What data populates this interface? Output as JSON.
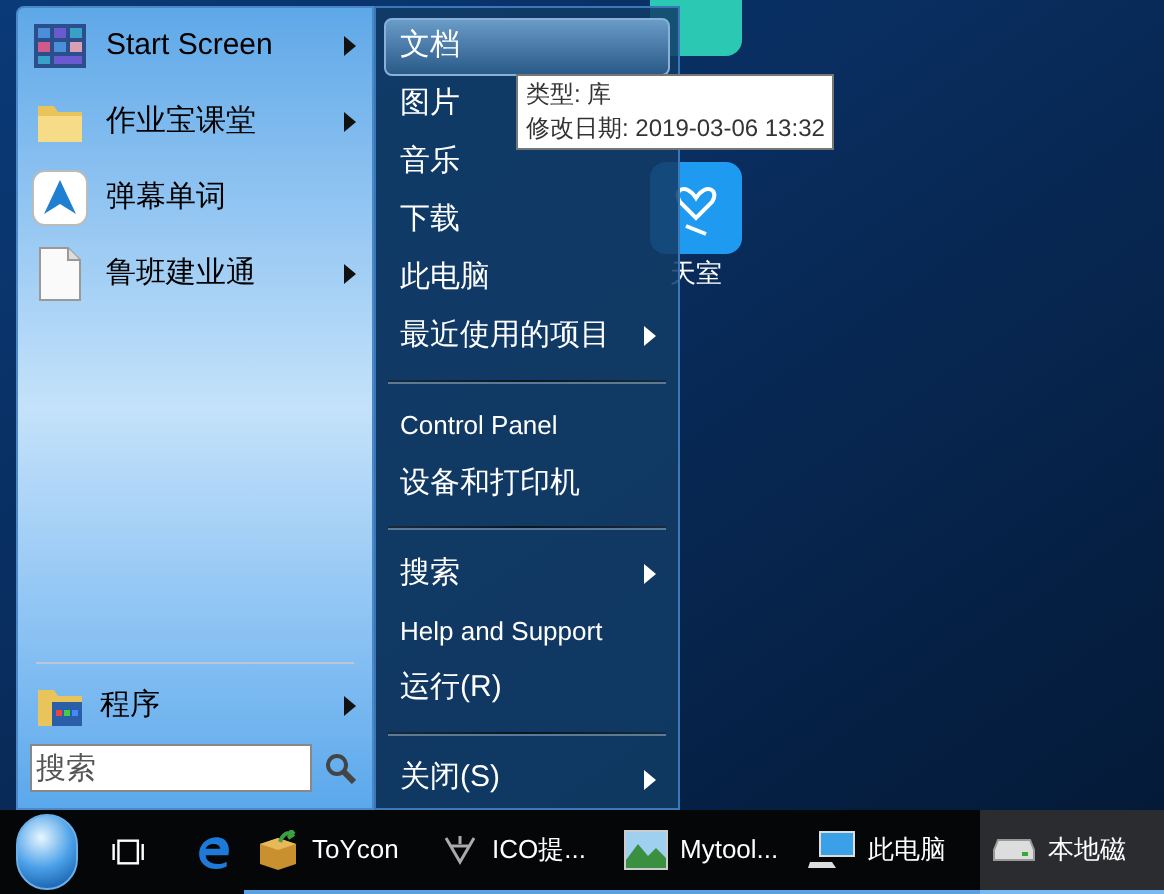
{
  "desktop_icon": {
    "label": "天室"
  },
  "start_menu": {
    "programs": [
      {
        "label": "Start Screen",
        "has_submenu": true
      },
      {
        "label": "作业宝课堂",
        "has_submenu": true
      },
      {
        "label": "弹幕单词",
        "has_submenu": false
      },
      {
        "label": "鲁班建业通",
        "has_submenu": true
      }
    ],
    "all_programs": {
      "label": "程序",
      "has_submenu": true
    },
    "search": {
      "placeholder": "搜索"
    },
    "places": [
      {
        "kind": "item",
        "label": "文档",
        "selected": true
      },
      {
        "kind": "item",
        "label": "图片",
        "selected": false
      },
      {
        "kind": "item",
        "label": "音乐",
        "selected": false,
        "has_submenu": false
      },
      {
        "kind": "item",
        "label": "下载",
        "selected": false,
        "has_submenu": false
      },
      {
        "kind": "item",
        "label": "此电脑",
        "selected": false,
        "has_submenu": false
      },
      {
        "kind": "item",
        "label": "最近使用的项目",
        "selected": false,
        "has_submenu": true
      },
      {
        "kind": "divider"
      },
      {
        "kind": "item",
        "label": "Control Panel",
        "selected": false,
        "has_submenu": false
      },
      {
        "kind": "item",
        "label": "设备和打印机",
        "selected": false,
        "has_submenu": false
      },
      {
        "kind": "divider"
      },
      {
        "kind": "item",
        "label": "搜索",
        "selected": false,
        "has_submenu": true
      },
      {
        "kind": "item",
        "label": "Help and Support",
        "selected": false,
        "has_submenu": false
      },
      {
        "kind": "item",
        "label": "运行(R)",
        "selected": false,
        "has_submenu": false
      },
      {
        "kind": "divider"
      },
      {
        "kind": "item",
        "label": "关闭(S)",
        "selected": false,
        "has_submenu": true
      }
    ]
  },
  "tooltip": {
    "lines": [
      "类型: 库",
      "修改日期: 2019-03-06 13:32"
    ]
  },
  "taskbar": {
    "items": [
      {
        "label": "ToYcon",
        "selected": false
      },
      {
        "label": "ICO提...",
        "selected": false
      },
      {
        "label": "Mytool...",
        "selected": false
      },
      {
        "label": "此电脑",
        "selected": false
      },
      {
        "label": "本地磁",
        "selected": true
      }
    ]
  }
}
